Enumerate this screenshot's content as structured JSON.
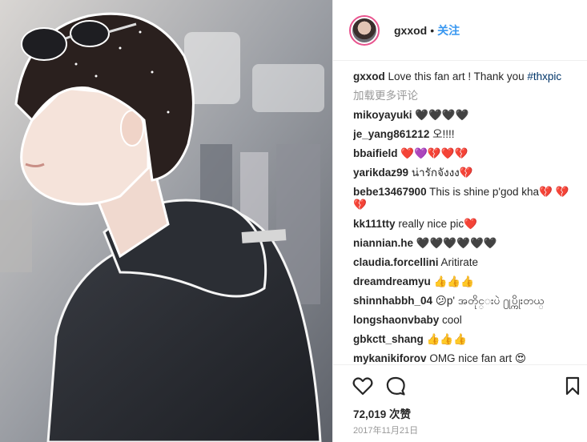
{
  "header": {
    "username": "gxxod",
    "dot": "•",
    "follow": "关注"
  },
  "caption": {
    "username": "gxxod",
    "text": "Love this fan art ! Thank you ",
    "hashtag": "#thxpic"
  },
  "load_more": "加载更多评论",
  "comments": [
    {
      "user": "mikoyayuki",
      "text": "🖤🖤🖤🖤"
    },
    {
      "user": "je_yang861212",
      "text": "오!!!!"
    },
    {
      "user": "bbaifield",
      "text": "❤️💜💔❤️💔"
    },
    {
      "user": "yarikdaz99",
      "text": "น่ารักจังงง💔"
    },
    {
      "user": "bebe13467900",
      "text": "This is shine p'god kha💔 💔💔"
    },
    {
      "user": "kk111tty",
      "text": "really nice pic❤️"
    },
    {
      "user": "niannian.he",
      "text": "🖤🖤🖤🖤🖤🖤"
    },
    {
      "user": "claudia.forcellini",
      "text": "Aritirate"
    },
    {
      "user": "dreamdreamyu",
      "text": "👍👍👍"
    },
    {
      "user": "shinnhabbh_04",
      "text": "😕p' အတိုင္းပဲ ႐ုပ္ကိုးတယ္"
    },
    {
      "user": "longshaonvbaby",
      "text": "cool"
    },
    {
      "user": "gbkctt_shang",
      "text": "👍👍👍"
    },
    {
      "user": "mykanikiforov",
      "text": "OMG nice fan art 😍"
    }
  ],
  "likes": "72,019 次赞",
  "date": "2017年11月21日",
  "icons": [
    "heart-icon",
    "comment-icon",
    "bookmark-icon"
  ],
  "colors": {
    "link": "#3897f0",
    "hashtag": "#003569",
    "muted": "#999999",
    "ring": "#e8548e"
  }
}
